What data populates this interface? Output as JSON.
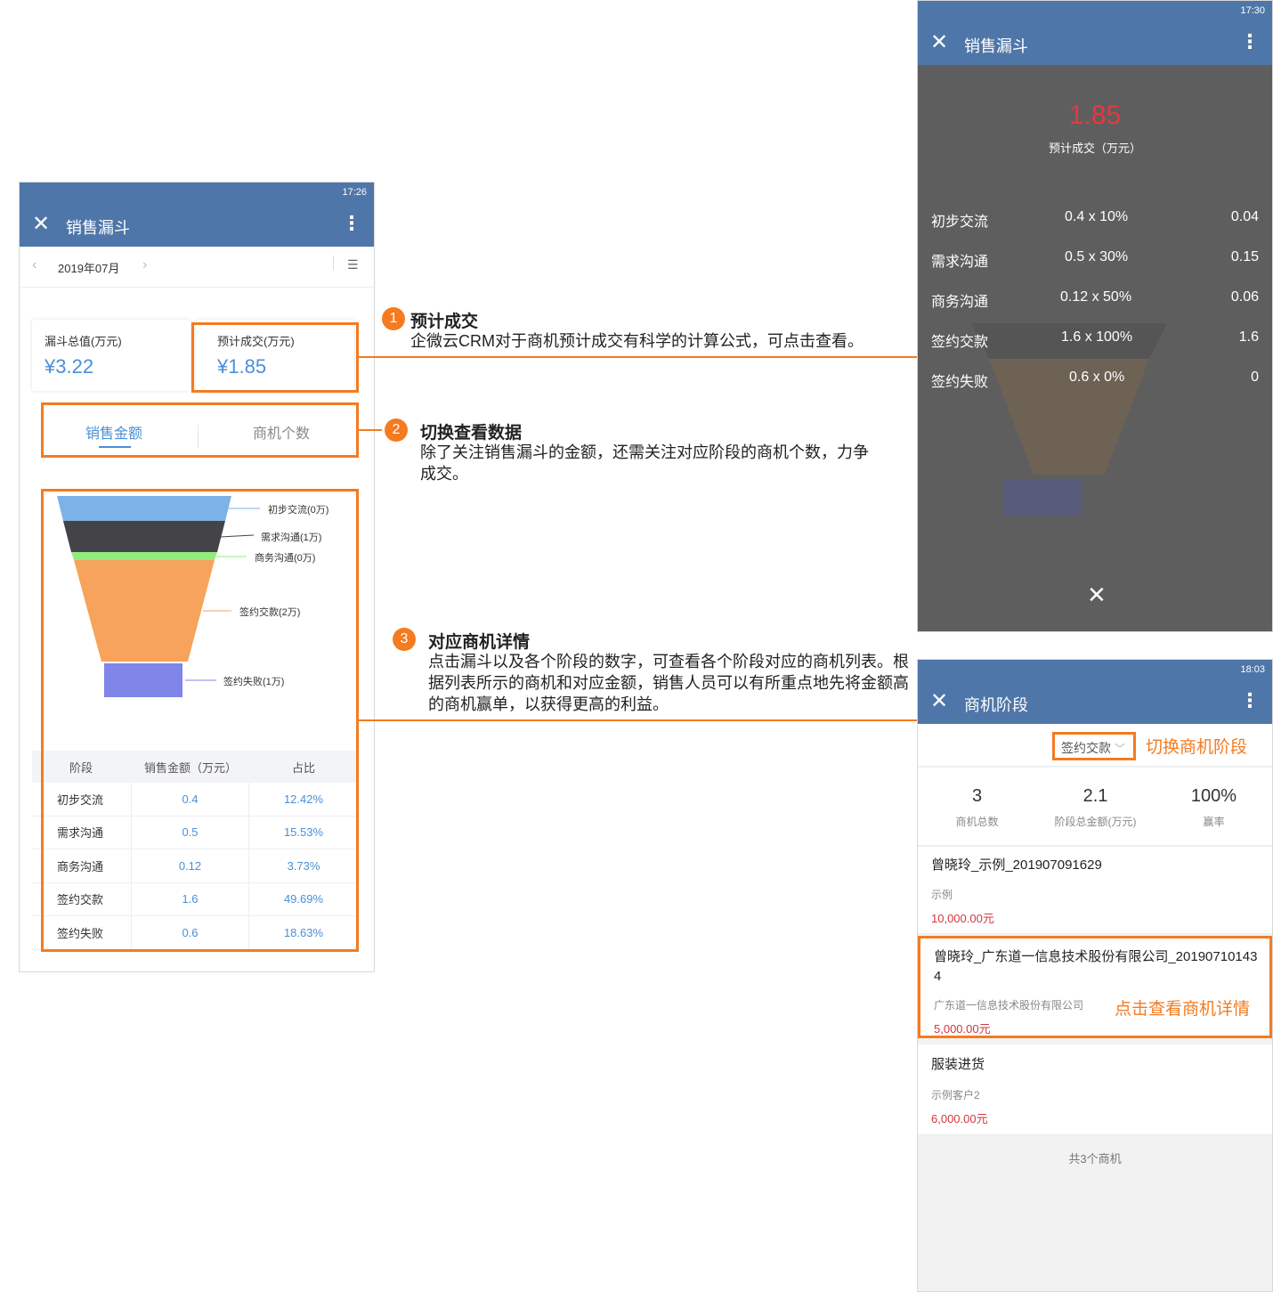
{
  "left_phone": {
    "status_time": "17:26",
    "title": "销售漏斗",
    "date": "2019年07月",
    "summary": [
      {
        "label": "漏斗总值(万元)",
        "value": "¥3.22"
      },
      {
        "label": "预计成交(万元)",
        "value": "¥1.85"
      }
    ],
    "tabs": [
      "销售金额",
      "商机个数"
    ],
    "funnel_labels": [
      "初步交流(0万)",
      "需求沟通(1万)",
      "商务沟通(0万)",
      "签约交款(2万)",
      "签约失败(1万)"
    ],
    "table": {
      "headers": [
        "阶段",
        "销售金额（万元）",
        "占比"
      ],
      "rows": [
        [
          "初步交流",
          "0.4",
          "12.42%"
        ],
        [
          "需求沟通",
          "0.5",
          "15.53%"
        ],
        [
          "商务沟通",
          "0.12",
          "3.73%"
        ],
        [
          "签约交款",
          "1.6",
          "49.69%"
        ],
        [
          "签约失败",
          "0.6",
          "18.63%"
        ]
      ]
    }
  },
  "annotations": [
    {
      "num": "1",
      "title": "预计成交",
      "text": "企微云CRM对于商机预计成交有科学的计算公式，可点击查看。"
    },
    {
      "num": "2",
      "title": "切换查看数据",
      "text": "除了关注销售漏斗的金额，还需关注对应阶段的商机个数，力争成交。"
    },
    {
      "num": "3",
      "title": "对应商机详情",
      "text": "点击漏斗以及各个阶段的数字，可查看各个阶段对应的商机列表。根据列表所示的商机和对应金额，销售人员可以有所重点地先将金额高的商机赢单，以获得更高的利益。"
    }
  ],
  "overlay_phone": {
    "status_time": "17:30",
    "title": "销售漏斗",
    "big_value": "1.85",
    "big_label": "预计成交（万元）",
    "rows": [
      {
        "stage": "初步交流",
        "formula": "0.4 x 10%",
        "result": "0.04"
      },
      {
        "stage": "需求沟通",
        "formula": "0.5 x 30%",
        "result": "0.15"
      },
      {
        "stage": "商务沟通",
        "formula": "0.12 x 50%",
        "result": "0.06"
      },
      {
        "stage": "签约交款",
        "formula": "1.6 x 100%",
        "result": "1.6"
      },
      {
        "stage": "签约失败",
        "formula": "0.6 x 0%",
        "result": "0"
      }
    ],
    "close_icon": "close-icon"
  },
  "stage_phone": {
    "status_time": "18:03",
    "title": "商机阶段",
    "stage_select": "签约交款",
    "stage_hint": "切换商机阶段",
    "stats": [
      {
        "value": "3",
        "label": "商机总数"
      },
      {
        "value": "2.1",
        "label": "阶段总金额(万元)"
      },
      {
        "value": "100%",
        "label": "赢率"
      }
    ],
    "opportunities": [
      {
        "name": "曾晓玲_示例_201907091629",
        "customer": "示例",
        "amount": "10,000.00元"
      },
      {
        "name": "曾晓玲_广东道一信息技术股份有限公司_201907101434",
        "customer": "广东道一信息技术股份有限公司",
        "amount": "5,000.00元"
      },
      {
        "name": "服装进货",
        "customer": "示例客户2",
        "amount": "6,000.00元"
      }
    ],
    "detail_hint": "点击查看商机详情",
    "footer": "共3个商机"
  },
  "colors": {
    "accent": "#f47b20",
    "appbar": "#4f76a8",
    "link": "#4a8fd6",
    "danger": "#e8383d"
  }
}
